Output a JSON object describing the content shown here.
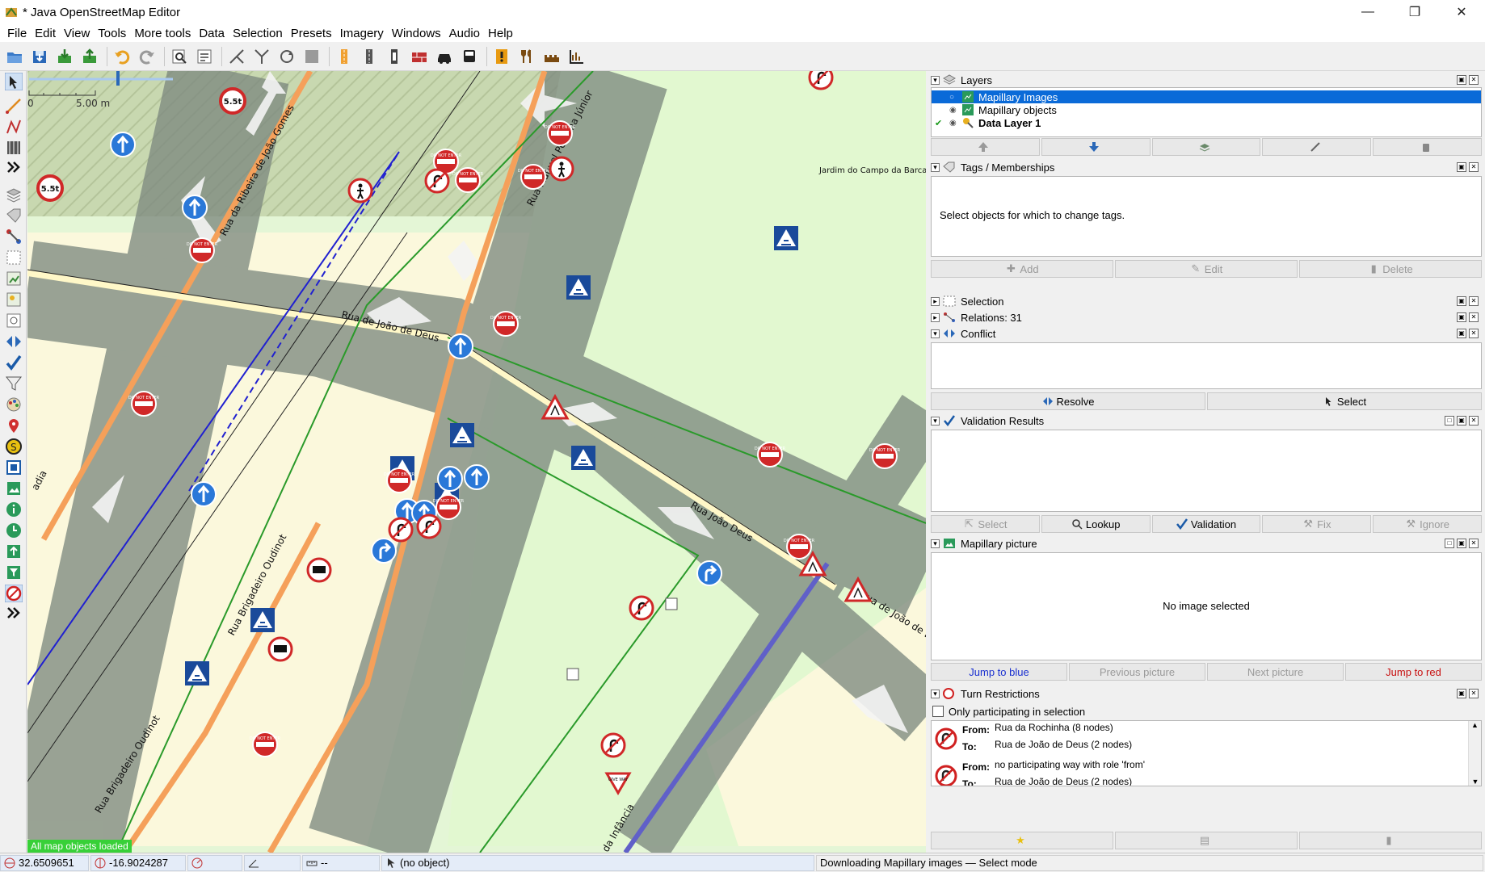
{
  "window": {
    "title": "* Java OpenStreetMap Editor",
    "minimize": "—",
    "maximize": "❐",
    "close": "✕"
  },
  "menu": [
    "File",
    "Edit",
    "View",
    "Tools",
    "More tools",
    "Data",
    "Selection",
    "Presets",
    "Imagery",
    "Windows",
    "Audio",
    "Help"
  ],
  "map": {
    "scale_zero": "0",
    "scale_label": "5.00 m",
    "loaded_text": "All map objects loaded",
    "street_labels": [
      "Rua da Ribeira de João Gomes",
      "Rua Manuel Pestana Júnior",
      "Jardim do Campo da Barca",
      "Rua de João de Deus",
      "Rua João Deus",
      "Rua Brigadeiro Oudinot",
      "Rua Brigadeiro Oudinot",
      "Rua de João de Deus",
      "da Infância",
      "adia"
    ],
    "speed_limit": "5.5t",
    "do_not_enter": "DO NOT ENTER",
    "give_way": "GIVE WAY"
  },
  "layers": {
    "title": "Layers",
    "items": [
      {
        "name": "Mapillary Images",
        "selected": true,
        "active": false
      },
      {
        "name": "Mapillary objects",
        "selected": false,
        "active": false
      },
      {
        "name": "Data Layer 1",
        "selected": false,
        "active": true
      }
    ]
  },
  "tags": {
    "title": "Tags / Memberships",
    "empty": "Select objects for which to change tags.",
    "add": "Add",
    "edit": "Edit",
    "delete": "Delete"
  },
  "selection": {
    "title": "Selection"
  },
  "relations": {
    "title": "Relations: 31"
  },
  "conflict": {
    "title": "Conflict",
    "resolve": "Resolve",
    "select": "Select"
  },
  "validation": {
    "title": "Validation Results",
    "select": "Select",
    "lookup": "Lookup",
    "validation": "Validation",
    "fix": "Fix",
    "ignore": "Ignore"
  },
  "mapillary": {
    "title": "Mapillary picture",
    "empty": "No image selected",
    "jump_blue": "Jump to blue",
    "previous": "Previous picture",
    "next": "Next picture",
    "jump_red": "Jump to red"
  },
  "turn": {
    "title": "Turn Restrictions",
    "only_participating": "Only participating in selection",
    "from_label": "From:",
    "to_label": "To:",
    "entries": [
      {
        "from": "Rua da Rochinha (8 nodes)",
        "to": "Rua de João de Deus (2 nodes)"
      },
      {
        "from": "no participating way with role 'from'",
        "to": "Rua de João de Deus (2 nodes)"
      }
    ]
  },
  "status": {
    "lat": "32.6509651",
    "lon": "-16.9024287",
    "heading": "",
    "angle": "",
    "distance": "--",
    "object": "(no object)",
    "message": "Downloading Mapillary images — Select mode"
  },
  "colors": {
    "selection_blue": "#0a6ad8",
    "map_bg": "#e6f8d8",
    "road_gray": "#7e8a80",
    "primary_orange": "#f5a05a",
    "loaded_green": "#38d038"
  }
}
